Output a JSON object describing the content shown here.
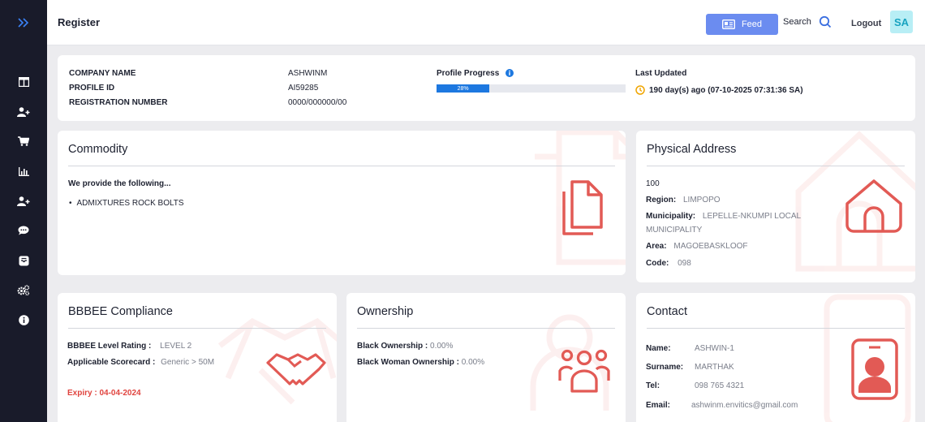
{
  "topbar": {
    "title": "Register",
    "feed_label": "Feed",
    "search_label": "Search",
    "logout_label": "Logout",
    "avatar_initials": "SA"
  },
  "sidebar": {
    "icons": [
      "double-chevron-right-icon",
      "dashboard-icon",
      "add-user-icon",
      "cart-icon",
      "bar-chart-icon",
      "add-user-icon",
      "chat-icon",
      "inbox-icon",
      "gears-icon",
      "info-icon"
    ]
  },
  "profile": {
    "company_name_label": "COMPANY NAME",
    "company_name": "ASHWINM",
    "profile_id_label": "PROFILE ID",
    "profile_id": "AI59285",
    "registration_label": "REGISTRATION NUMBER",
    "registration_number": "0000/000000/00",
    "progress_label": "Profile Progress",
    "progress_value": 28,
    "progress_text": "28%",
    "last_updated_label": "Last Updated",
    "last_updated_value": "190 day(s) ago (07-10-2025 07:31:36 SA)"
  },
  "commodity": {
    "title": "Commodity",
    "intro": "We provide the following...",
    "items": [
      "ADMIXTURES ROCK BOLTS"
    ]
  },
  "address": {
    "title": "Physical Address",
    "line1": "100",
    "region_label": "Region:",
    "region": "LIMPOPO",
    "municipality_label": "Municipality:",
    "municipality_line1": "LEPELLE-NKUMPI LOCAL",
    "municipality_line2": "MUNICIPALITY",
    "area_label": "Area:",
    "area": "MAGOEBASKLOOF",
    "code_label": "Code:",
    "code": "098"
  },
  "bbbee": {
    "title": "BBBEE Compliance",
    "level_label": "BBBEE Level Rating :",
    "level": "LEVEL 2",
    "scorecard_label": "Applicable Scorecard :",
    "scorecard": "Generic > 50M",
    "expiry": "Expiry : 04-04-2024"
  },
  "ownership": {
    "title": "Ownership",
    "black_label": "Black Ownership :",
    "black_value": "0.00%",
    "black_woman_label": "Black Woman Ownership :",
    "black_woman_value": "0.00%"
  },
  "contact": {
    "title": "Contact",
    "name_label": "Name:",
    "name": "ASHWIN-1",
    "surname_label": "Surname:",
    "surname": "MARTHAK",
    "tel_label": "Tel:",
    "tel": "098 765 4321",
    "email_label": "Email:",
    "email": "ashwinm.envitics@gmail.com"
  },
  "colors": {
    "sidebar_bg": "#191b2a",
    "accent_blue": "#6b8cf0",
    "progress_blue": "#1d78e0",
    "icon_red": "#e25a55",
    "expiry_red": "#e0443f",
    "avatar_bg": "#b8eef5"
  }
}
